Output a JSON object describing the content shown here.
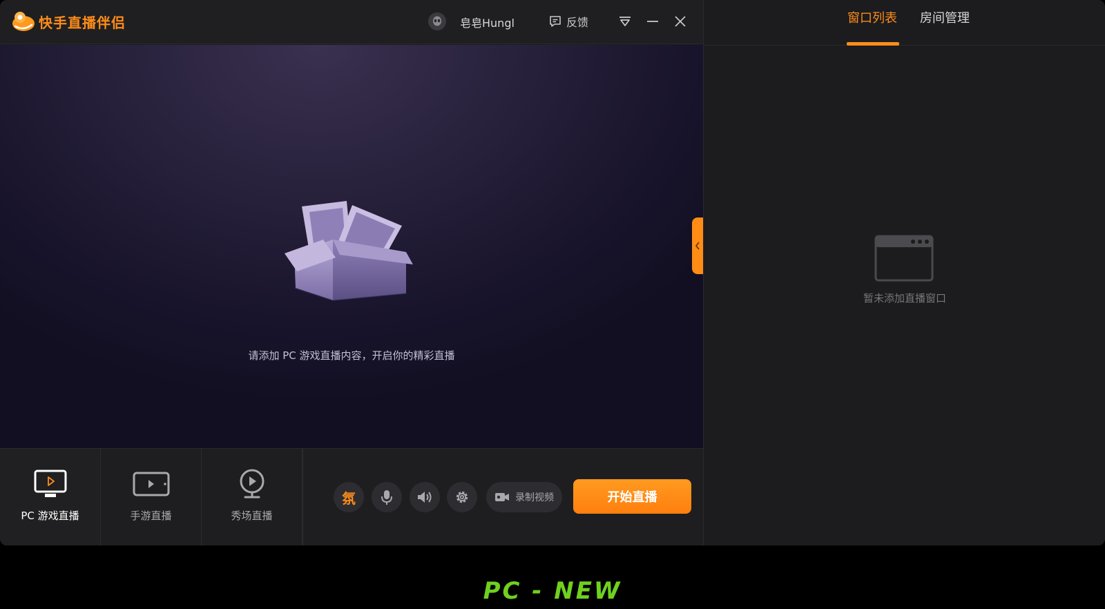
{
  "app": {
    "title": "快手直播伴侣",
    "user_name": "皂皂Hungl",
    "feedback_label": "反馈"
  },
  "preview": {
    "empty_hint": "请添加 PC 游戏直播内容，开启你的精彩直播"
  },
  "modes": [
    {
      "label": "PC 游戏直播",
      "icon": "monitor-icon",
      "active": true
    },
    {
      "label": "手游直播",
      "icon": "tablet-icon",
      "active": false
    },
    {
      "label": "秀场直播",
      "icon": "webcam-icon",
      "active": false
    }
  ],
  "controls": {
    "atmosphere_glyph": "氛",
    "record_label": "录制视频",
    "start_label": "开始直播"
  },
  "right_panel": {
    "tabs": [
      {
        "label": "窗口列表",
        "active": true
      },
      {
        "label": "房间管理",
        "active": false
      }
    ],
    "empty_text": "暂未添加直播窗口"
  },
  "caption": "PC - NEW",
  "colors": {
    "accent": "#ff8d1a",
    "caption_green": "#6fd11f"
  }
}
